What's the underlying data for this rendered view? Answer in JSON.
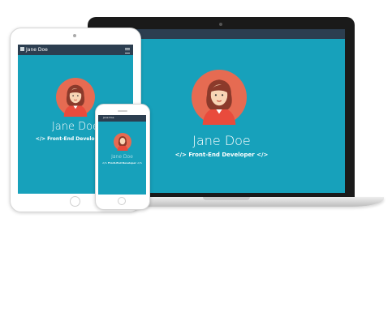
{
  "profile": {
    "name": "Jane Doe",
    "subtitle": "</> Front-End Developer </>"
  },
  "tablet": {
    "brand": "Jane Doe"
  },
  "phone": {
    "brand": "Jane Doe"
  },
  "colors": {
    "screen_bg": "#17a1bb",
    "navbar_bg": "#2c3e50",
    "avatar_bg": "#e66b52",
    "hair": "#8b3a2b",
    "jacket": "#e94b3c"
  },
  "icons": [
    "hamburger-menu-icon",
    "brand-icon",
    "avatar-illustration"
  ]
}
